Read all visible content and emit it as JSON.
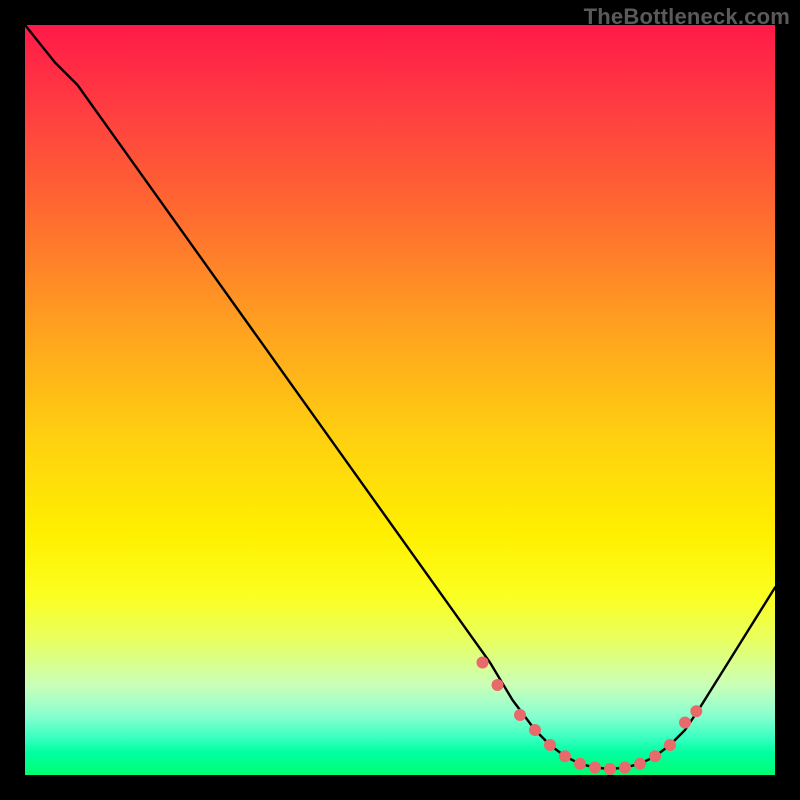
{
  "watermark": "TheBottleneck.com",
  "chart_data": {
    "type": "line",
    "title": "",
    "xlabel": "",
    "ylabel": "",
    "xlim": [
      0,
      100
    ],
    "ylim": [
      0,
      100
    ],
    "series": [
      {
        "name": "bottleneck-curve",
        "x": [
          0,
          4,
          7,
          62,
          65,
          68,
          70,
          72,
          74,
          76,
          78,
          80,
          82,
          84,
          86,
          88,
          90,
          100
        ],
        "values": [
          100,
          95,
          92,
          15,
          10,
          6,
          4,
          2.5,
          1.5,
          1,
          0.8,
          1,
          1.5,
          2.5,
          4,
          6,
          9,
          25
        ]
      }
    ],
    "markers": {
      "name": "highlight-dots",
      "color": "#e86a6a",
      "x": [
        61,
        63,
        66,
        68,
        70,
        72,
        74,
        76,
        78,
        80,
        82,
        84,
        86,
        88,
        89.5
      ],
      "values": [
        15,
        12,
        8,
        6,
        4,
        2.5,
        1.5,
        1,
        0.8,
        1,
        1.5,
        2.5,
        4,
        7,
        8.5
      ]
    },
    "gradient_stops": [
      {
        "pos": 0,
        "color": "#ff1a49"
      },
      {
        "pos": 25,
        "color": "#ff6a30"
      },
      {
        "pos": 55,
        "color": "#ffd010"
      },
      {
        "pos": 76,
        "color": "#fbff20"
      },
      {
        "pos": 100,
        "color": "#00ff70"
      }
    ]
  }
}
